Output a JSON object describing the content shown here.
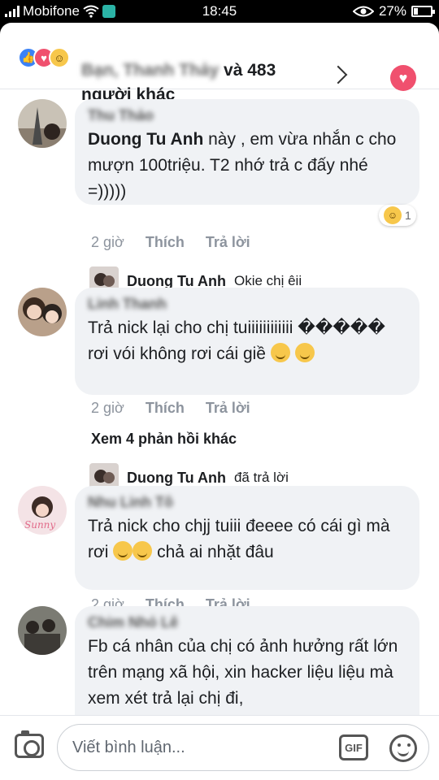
{
  "status_bar": {
    "carrier": "Mobifone",
    "time": "18:45",
    "battery": "27%",
    "battery_fraction": 0.27
  },
  "header": {
    "reacted_names_blurred": "Bạn, Thanh Thảy",
    "reaction_summary": "và 483 người khác",
    "reaction_icons": [
      "like-icon",
      "love-icon",
      "haha-icon"
    ]
  },
  "comments": [
    {
      "author_blurred": "Thu Thảo",
      "tag": "Duong Tu Anh",
      "text": " này , em vừa nhắn c cho mượn 100triệu. T2 nhớ trả c đấy nhé  =)))))",
      "time": "2 giờ",
      "like_label": "Thích",
      "reply_label": "Trả lời",
      "reaction_count": "1",
      "reply": {
        "name": "Duong Tu Anh",
        "text": "Okie chị êii"
      }
    },
    {
      "author_blurred": "Linh Thanh",
      "text": "Trả nick lại cho chị tuiiiiiiiiiiii ����� rơi vói không rơi cái giề",
      "time": "2 giờ",
      "like_label": "Thích",
      "reply_label": "Trả lời",
      "more_replies": "Xem 4 phản hồi khác",
      "reply": {
        "name": "Duong Tu Anh",
        "text": "đã trả lời"
      }
    },
    {
      "author_blurred": "Nhu Linh Tô",
      "text": "Trả nick cho chjj tuiii đeeee có cái gì mà rơi",
      "text_after": "chả ai nhặt đâu",
      "time": "2 giờ",
      "like_label": "Thích",
      "reply_label": "Trả lời"
    },
    {
      "author_blurred": "Chim Nhỏ Lê",
      "text": "Fb cá nhân của chị có ảnh hưởng rất lớn trên mạng xã hội, xin hacker liệu liệu mà xem xét trả lại chị đi,",
      "time": "",
      "like_label": "",
      "reply_label": ""
    }
  ],
  "composer": {
    "placeholder": "Viết bình luận...",
    "gif_label": "GIF"
  },
  "colors": {
    "like": "#3b82f6",
    "love": "#f0506e",
    "bubble": "#f0f2f5",
    "meta_text": "#8d949e"
  }
}
